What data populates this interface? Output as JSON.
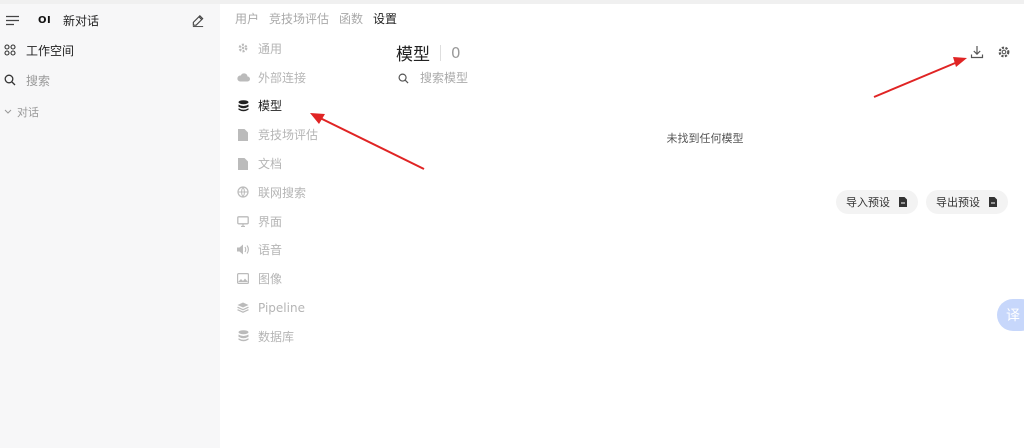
{
  "sidebar": {
    "logo_text": "OI",
    "new_chat": "新对话",
    "workspace": "工作空间",
    "search": "搜索",
    "chats_section": "对话"
  },
  "settings": {
    "tabs": [
      {
        "label": "用户",
        "active": false
      },
      {
        "label": "竞技场评估",
        "active": false
      },
      {
        "label": "函数",
        "active": false
      },
      {
        "label": "设置",
        "active": true
      }
    ],
    "menu": [
      {
        "label": "通用",
        "icon": "gear-icon",
        "active": false
      },
      {
        "label": "外部连接",
        "icon": "cloud-icon",
        "active": false
      },
      {
        "label": "模型",
        "icon": "database-icon",
        "active": true
      },
      {
        "label": "竞技场评估",
        "icon": "document-icon",
        "active": false
      },
      {
        "label": "文档",
        "icon": "document-icon",
        "active": false
      },
      {
        "label": "联网搜索",
        "icon": "globe-icon",
        "active": false
      },
      {
        "label": "界面",
        "icon": "monitor-icon",
        "active": false
      },
      {
        "label": "语音",
        "icon": "speaker-icon",
        "active": false
      },
      {
        "label": "图像",
        "icon": "image-icon",
        "active": false
      },
      {
        "label": "Pipeline",
        "icon": "stack-icon",
        "active": false
      },
      {
        "label": "数据库",
        "icon": "database-icon",
        "active": false
      }
    ]
  },
  "models": {
    "title": "模型",
    "count": "0",
    "search_placeholder": "搜索模型",
    "empty_text": "未找到任何模型",
    "import_label": "导入预设",
    "export_label": "导出预设"
  },
  "floating": {
    "translate_label": "译"
  },
  "colors": {
    "annotation_arrow": "#e02424",
    "accent_blue": "#c7d7fb",
    "muted_text": "#b5b5b5"
  }
}
